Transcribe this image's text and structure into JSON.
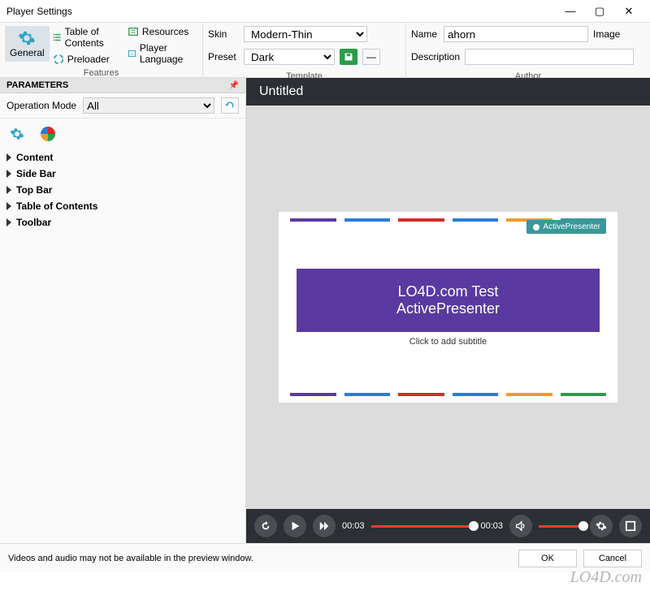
{
  "window": {
    "title": "Player Settings"
  },
  "ribbon": {
    "general": "General",
    "features": {
      "toc": "Table of Contents",
      "preloader": "Preloader",
      "resources": "Resources",
      "player_lang": "Player Language",
      "label": "Features"
    },
    "template": {
      "skin_label": "Skin",
      "skin_value": "Modern-Thin",
      "preset_label": "Preset",
      "preset_value": "Dark",
      "label": "Template"
    },
    "author": {
      "name_label": "Name",
      "name_value": "ahorn",
      "image_label": "Image",
      "desc_label": "Description",
      "desc_value": "",
      "label": "Author"
    }
  },
  "parameters": {
    "header": "PARAMETERS",
    "opmode_label": "Operation Mode",
    "opmode_value": "All"
  },
  "tree": {
    "items": [
      "Content",
      "Side Bar",
      "Top Bar",
      "Table of Contents",
      "Toolbar"
    ]
  },
  "preview": {
    "title": "Untitled",
    "slide_title_l1": "LO4D.com Test",
    "slide_title_l2": "ActivePresenter",
    "subtitle": "Click to add subtitle",
    "badge": "ActivePresenter",
    "colors": [
      "#5a3aa0",
      "#2b7bd6",
      "#d62b2b",
      "#2b7bd6",
      "#f29b2b",
      "#2b9c4c"
    ]
  },
  "playbar": {
    "elapsed": "00:03",
    "total": "00:03"
  },
  "footer": {
    "status": "Videos and audio may not be available in the preview window.",
    "ok": "OK",
    "cancel": "Cancel"
  },
  "watermark": "LO4D.com"
}
